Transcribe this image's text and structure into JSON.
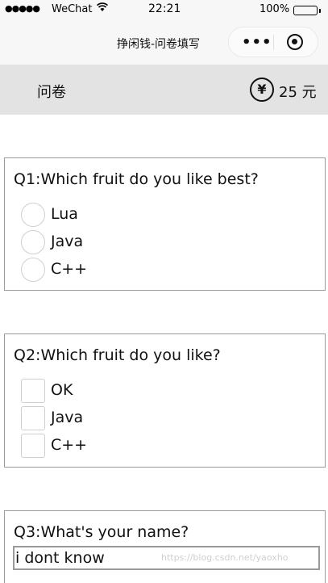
{
  "status_bar": {
    "signal": "●●●●●",
    "carrier": "WeChat",
    "time": "22:21",
    "battery_pct": "100%"
  },
  "nav": {
    "title": "挣闲钱-问卷填写",
    "more": "•••"
  },
  "header": {
    "title": "问卷",
    "coin_symbol": "¥",
    "amount": "25 元"
  },
  "questions": {
    "q1": {
      "title": "Q1:Which fruit do you like best?",
      "type": "radio",
      "options": [
        "Lua",
        "Java",
        "C++"
      ]
    },
    "q2": {
      "title": "Q2:Which fruit do you like?",
      "type": "checkbox",
      "options": [
        "OK",
        "Java",
        "C++"
      ]
    },
    "q3": {
      "title": "Q3:What's your name?",
      "type": "text",
      "value": "i dont know"
    }
  },
  "watermark": "https://blog.csdn.net/yaoxho"
}
